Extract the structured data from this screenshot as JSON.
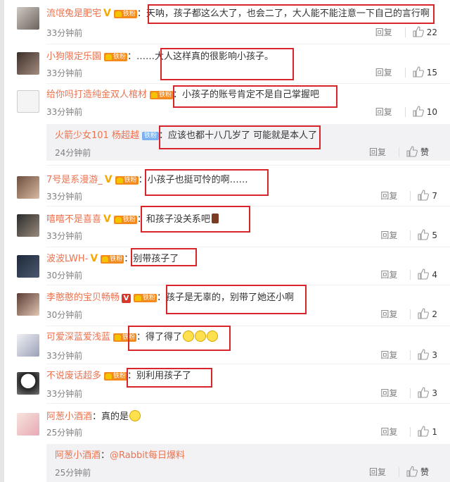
{
  "comments": [
    {
      "user": "流氓兔是肥宅",
      "text": "天呐，孩子都这么大了，也会二了，大人能不能注意一下自己的言行啊",
      "time": "33分钟前",
      "reply": "回复",
      "likes": "22"
    },
    {
      "user": "小狗限定乐園",
      "text": "……大人这样真的很影响小孩子。",
      "time": "33分钟前",
      "reply": "回复",
      "likes": "15"
    },
    {
      "user": "给你吗打造纯金双人棺材",
      "text": "小孩子的账号肯定不是自己掌握吧",
      "time": "33分钟前",
      "reply": "回复",
      "likes": "10"
    },
    {
      "user": "7号是系漫游_",
      "text": "小孩子也挺可怜的啊……",
      "time": "33分钟前",
      "reply": "回复",
      "likes": "7"
    },
    {
      "user": "嘻嘻不是喜喜",
      "text": "和孩子没关系吧",
      "time": "33分钟前",
      "reply": "回复",
      "likes": "5"
    },
    {
      "user": "波波LWH-",
      "text": "别带孩子了",
      "time": "30分钟前",
      "reply": "回复",
      "likes": "4"
    },
    {
      "user": "李憨憨的宝贝畅畅",
      "text": "孩子是无辜的，别带了她还小啊",
      "time": "30分钟前",
      "reply": "回复",
      "likes": "2"
    },
    {
      "user": "可爱深蓝爱浅蓝",
      "text": "得了得了",
      "time": "33分钟前",
      "reply": "回复",
      "likes": "3"
    },
    {
      "user": "不说废话超多",
      "text": "别利用孩子了",
      "time": "33分钟前",
      "reply": "回复",
      "likes": "3"
    },
    {
      "user": "阿葱小酒酒",
      "text": "真的是",
      "time": "25分钟前",
      "reply": "回复",
      "likes": "1"
    }
  ],
  "subreplies": [
    {
      "user": "火箭少女101 杨超越",
      "badge": "铁粉",
      "text": "应该也都十八几岁了 可能就是本人了",
      "time": "24分钟前",
      "reply": "回复",
      "likes": "赞"
    },
    {
      "user": "阿葱小酒酒",
      "text": "@Rabbit每日爆料",
      "time": "25分钟前",
      "reply": "回复",
      "likes": "赞"
    }
  ],
  "fan_label": "铁粉",
  "colpon": "：",
  "colors": {
    "username": "#eb7350",
    "highlight": "#d8242b",
    "badge": "#f28a1d"
  }
}
